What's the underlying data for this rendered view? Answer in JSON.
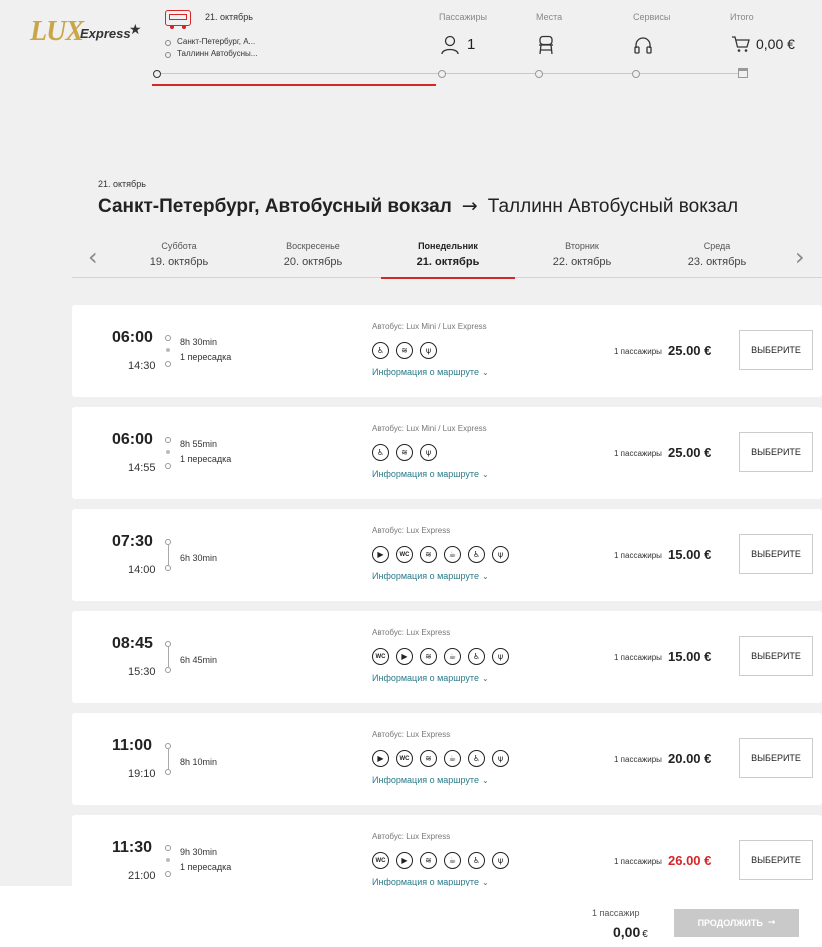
{
  "brand": {
    "logo_main": "LUX",
    "logo_sub": "Express"
  },
  "trip": {
    "date": "21. октябрь",
    "from_short": "Санкт-Петербург, А...",
    "to_short": "Таллинн Автобусны..."
  },
  "steps": {
    "passengers": {
      "label": "Пассажиры",
      "value": "1"
    },
    "seats": {
      "label": "Места"
    },
    "services": {
      "label": "Сервисы"
    },
    "total": {
      "label": "Итого",
      "value": "0,00 €"
    }
  },
  "route": {
    "date": "21. октябрь",
    "from": "Санкт-Петербург, Автобусный вокзал",
    "arrow": "→",
    "to": "Таллинн Автобусный вокзал"
  },
  "days": [
    {
      "name": "Суббота",
      "date": "19. октябрь"
    },
    {
      "name": "Воскресенье",
      "date": "20. октябрь"
    },
    {
      "name": "Понедельник",
      "date": "21. октябрь",
      "active": true
    },
    {
      "name": "Вторник",
      "date": "22. октябрь"
    },
    {
      "name": "Среда",
      "date": "23. октябрь"
    }
  ],
  "nav": {
    "prev": "‹",
    "next": "›"
  },
  "labels": {
    "info": "Информация о маршруте",
    "select": "ВЫБЕРИТЕ",
    "pax": "1 пассажиры"
  },
  "trips": [
    {
      "dep": "06:00",
      "arr": "14:30",
      "dur": "8h 30min",
      "transfer": "1 пересадка",
      "bus": "Автобус: Lux Mini / Lux Express",
      "icons": [
        "seat-icon",
        "wifi-icon",
        "usb-icon"
      ],
      "price": "25.00 €",
      "price_color": "#222222"
    },
    {
      "dep": "06:00",
      "arr": "14:55",
      "dur": "8h 55min",
      "transfer": "1 пересадка",
      "bus": "Автобус: Lux Mini / Lux Express",
      "icons": [
        "seat-icon",
        "wifi-icon",
        "usb-icon"
      ],
      "price": "25.00 €",
      "price_color": "#222222"
    },
    {
      "dep": "07:30",
      "arr": "14:00",
      "dur": "6h 30min",
      "transfer": "",
      "bus": "Автобус: Lux Express",
      "icons": [
        "play-icon",
        "wc-icon",
        "wifi-icon",
        "coffee-icon",
        "seat-icon",
        "usb-icon"
      ],
      "price": "15.00 €",
      "price_color": "#222222"
    },
    {
      "dep": "08:45",
      "arr": "15:30",
      "dur": "6h 45min",
      "transfer": "",
      "bus": "Автобус: Lux Express",
      "icons": [
        "wc-icon",
        "play-icon",
        "wifi-icon",
        "coffee-icon",
        "seat-icon",
        "usb-icon"
      ],
      "price": "15.00 €",
      "price_color": "#222222"
    },
    {
      "dep": "11:00",
      "arr": "19:10",
      "dur": "8h 10min",
      "transfer": "",
      "bus": "Автобус: Lux Express",
      "icons": [
        "play-icon",
        "wc-icon",
        "wifi-icon",
        "coffee-icon",
        "seat-icon",
        "usb-icon"
      ],
      "price": "20.00 €",
      "price_color": "#222222"
    },
    {
      "dep": "11:30",
      "arr": "21:00",
      "dur": "9h 30min",
      "transfer": "1 пересадка",
      "bus": "Автобус: Lux Express",
      "icons": [
        "wc-icon",
        "play-icon",
        "wifi-icon",
        "coffee-icon",
        "seat-icon",
        "usb-icon"
      ],
      "price": "26.00 €",
      "price_color": "#d42727"
    }
  ],
  "footer": {
    "pax": "1 пассажир",
    "total": "0,00",
    "currency": "€",
    "continue": "ПРОДОЛЖИТЬ",
    "continue_arrow": "→"
  },
  "colors": {
    "accent": "#d42727",
    "link": "#2a7b8a",
    "background": "#f0f0f0"
  }
}
